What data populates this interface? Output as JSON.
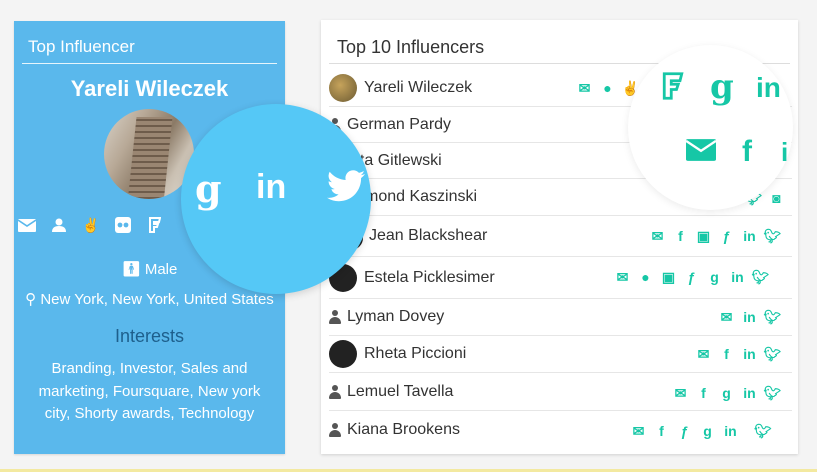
{
  "left_card": {
    "title": "Top Influencer",
    "name": "Yareli Wileczek",
    "gender": "Male",
    "location": "New York, New York, United States",
    "interests_title": "Interests",
    "interests": "Branding, Investor, Sales and marketing, Foursquare, New york city, Shorty awards, Technology"
  },
  "right_card": {
    "title": "Top 10 Influencers",
    "rows": [
      {
        "name": "Yareli Wileczek"
      },
      {
        "name": "German Pardy"
      },
      {
        "name": "eta Gitlewski"
      },
      {
        "name": "mond Kaszinski"
      },
      {
        "name": "Jean Blackshear"
      },
      {
        "name": "Estela Picklesimer"
      },
      {
        "name": "Lyman Dovey"
      },
      {
        "name": "Rheta Piccioni"
      },
      {
        "name": "Lemuel Tavella"
      },
      {
        "name": "Kiana Brookens"
      }
    ]
  },
  "colors": {
    "accent": "#16c7a6",
    "left_card_bg": "#5ab8ec",
    "bubble_blue": "#55c8f6",
    "interests_title": "#1e5f8c"
  }
}
